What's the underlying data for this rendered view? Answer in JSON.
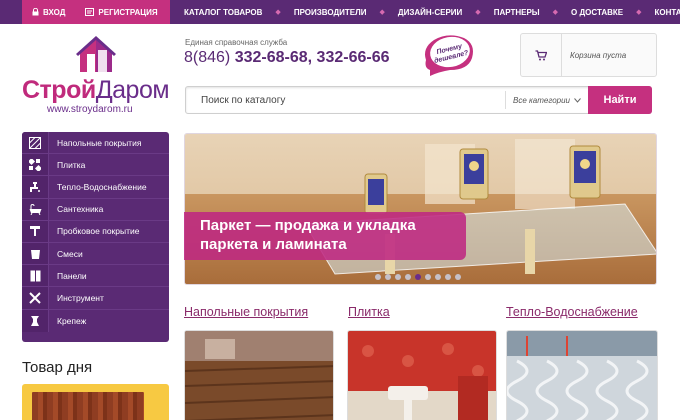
{
  "account": {
    "login": "ВХОД",
    "register": "РЕГИСТРАЦИЯ"
  },
  "nav": [
    "КАТАЛОГ ТОВАРОВ",
    "ПРОИЗВОДИТЕЛИ",
    "ДИЗАЙН-СЕРИИ",
    "ПАРТНЕРЫ",
    "О ДОСТАВКЕ",
    "КОНТАКТЫ"
  ],
  "logo": {
    "part1": "Строй",
    "part2": "Даром",
    "url": "www.stroydarom.ru"
  },
  "phone": {
    "label": "Единая справочная служба",
    "code": "8(846)",
    "numbers": "332-68-68, 332-66-66"
  },
  "why_badge": [
    "Почему",
    "дешевле?"
  ],
  "cart": {
    "text": "Корзина пуста"
  },
  "search": {
    "placeholder": "Поиск по каталогу",
    "category": "Все категории",
    "button": "Найти"
  },
  "sidebar": {
    "items": [
      {
        "label": "Напольные покрытия",
        "icon": "floor-icon"
      },
      {
        "label": "Плитка",
        "icon": "tile-icon"
      },
      {
        "label": "Тепло-Водоснабжение",
        "icon": "faucet-icon"
      },
      {
        "label": "Сантехника",
        "icon": "bathtub-icon"
      },
      {
        "label": "Пробковое покрытие",
        "icon": "cork-icon"
      },
      {
        "label": "Смеси",
        "icon": "bucket-icon"
      },
      {
        "label": "Панели",
        "icon": "panel-icon"
      },
      {
        "label": "Инструмент",
        "icon": "tools-icon"
      },
      {
        "label": "Крепеж",
        "icon": "fastener-icon"
      }
    ]
  },
  "product_of_day": {
    "title": "Товар дня"
  },
  "banner": {
    "line1": "Паркет — продажа и укладка",
    "line2": "паркета и ламината",
    "slides": 9,
    "active_slide": 4
  },
  "categories": [
    {
      "title": "Напольные покрытия"
    },
    {
      "title": "Плитка"
    },
    {
      "title": "Тепло-Водоснабжение"
    }
  ],
  "colors": {
    "purple": "#5a2a74",
    "magenta": "#c5307f",
    "yellow": "#f7c942"
  }
}
